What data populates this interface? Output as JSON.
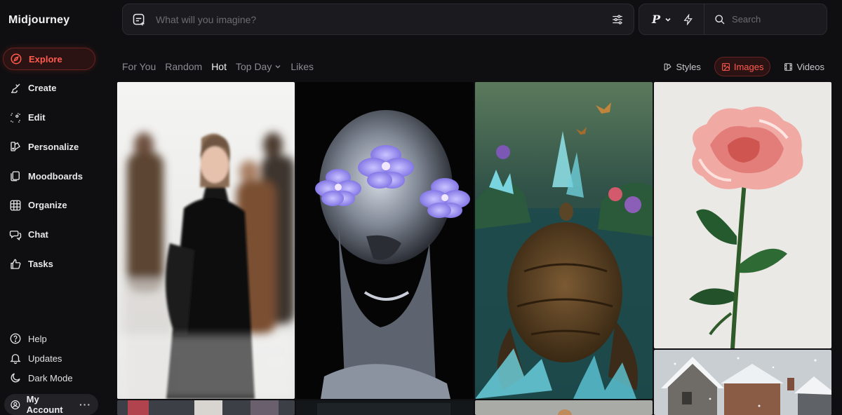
{
  "brand": "Midjourney",
  "nav": [
    {
      "label": "Explore",
      "icon": "compass-icon",
      "active": true
    },
    {
      "label": "Create",
      "icon": "brush-icon"
    },
    {
      "label": "Edit",
      "icon": "edit-frame-icon"
    },
    {
      "label": "Personalize",
      "icon": "palette-icon"
    },
    {
      "label": "Moodboards",
      "icon": "cards-icon"
    },
    {
      "label": "Organize",
      "icon": "grid-icon"
    },
    {
      "label": "Chat",
      "icon": "chat-icon"
    },
    {
      "label": "Tasks",
      "icon": "thumbs-up-icon"
    }
  ],
  "bottom_nav": [
    {
      "label": "Help",
      "icon": "help-icon"
    },
    {
      "label": "Updates",
      "icon": "bell-icon"
    },
    {
      "label": "Dark Mode",
      "icon": "moon-icon"
    }
  ],
  "account": {
    "label": "My Account",
    "more": "···"
  },
  "prompt": {
    "placeholder": "What will you imagine?"
  },
  "tools": {
    "personalize_label": "P",
    "search_placeholder": "Search"
  },
  "filters": [
    {
      "label": "For You"
    },
    {
      "label": "Random"
    },
    {
      "label": "Hot",
      "active": true
    },
    {
      "label": "Top Day",
      "dropdown": true
    },
    {
      "label": "Likes"
    }
  ],
  "media_tabs": [
    {
      "label": "Styles",
      "icon": "styles-icon"
    },
    {
      "label": "Images",
      "icon": "image-icon",
      "active": true
    },
    {
      "label": "Videos",
      "icon": "film-icon"
    }
  ],
  "colors": {
    "accent": "#ff5b4f",
    "background": "#0f0f11",
    "panel": "#1b1b1f"
  }
}
